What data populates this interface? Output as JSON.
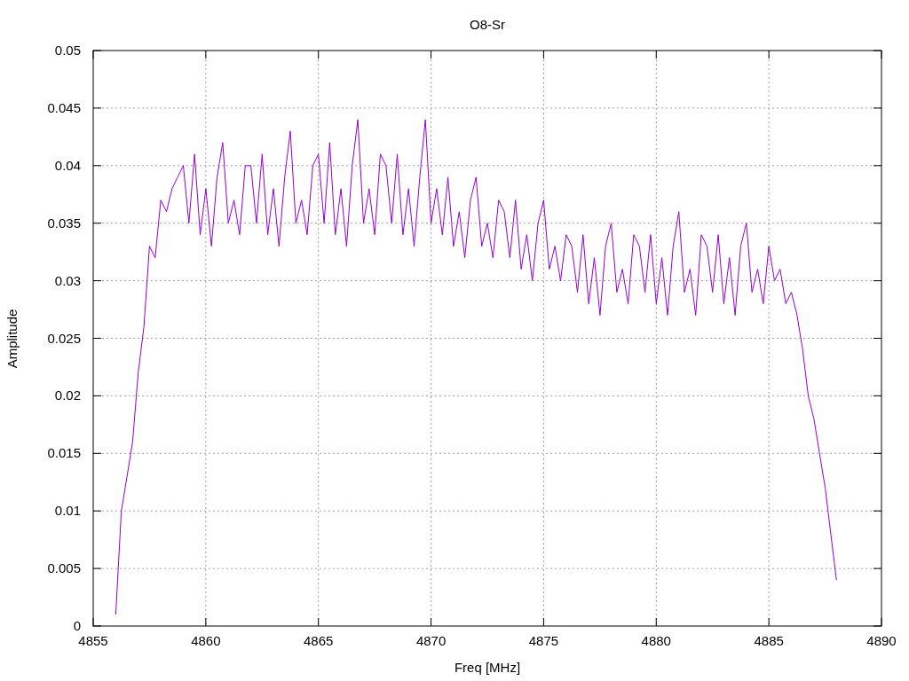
{
  "chart_data": {
    "type": "line",
    "title": "O8-Sr",
    "grid": true,
    "xlabel": "Freq [MHz]",
    "ylabel": "Amplitude",
    "xlim": [
      4855,
      4890
    ],
    "ylim": [
      0,
      0.05
    ],
    "xticks": [
      4855,
      4860,
      4865,
      4870,
      4875,
      4880,
      4885,
      4890
    ],
    "yticks": [
      0,
      0.005,
      0.01,
      0.015,
      0.02,
      0.025,
      0.03,
      0.035,
      0.04,
      0.045,
      0.05
    ],
    "x": [
      4856,
      4856.25,
      4856.5,
      4856.75,
      4857,
      4857.25,
      4857.5,
      4857.75,
      4858,
      4858.25,
      4858.5,
      4858.75,
      4859,
      4859.25,
      4859.5,
      4859.75,
      4860,
      4860.25,
      4860.5,
      4860.75,
      4861,
      4861.25,
      4861.5,
      4861.75,
      4862,
      4862.25,
      4862.5,
      4862.75,
      4863,
      4863.25,
      4863.5,
      4863.75,
      4864,
      4864.25,
      4864.5,
      4864.75,
      4865,
      4865.25,
      4865.5,
      4865.75,
      4866,
      4866.25,
      4866.5,
      4866.75,
      4867,
      4867.25,
      4867.5,
      4867.75,
      4868,
      4868.25,
      4868.5,
      4868.75,
      4869,
      4869.25,
      4869.5,
      4869.75,
      4870,
      4870.25,
      4870.5,
      4870.75,
      4871,
      4871.25,
      4871.5,
      4871.75,
      4872,
      4872.25,
      4872.5,
      4872.75,
      4873,
      4873.25,
      4873.5,
      4873.75,
      4874,
      4874.25,
      4874.5,
      4874.75,
      4875,
      4875.25,
      4875.5,
      4875.75,
      4876,
      4876.25,
      4876.5,
      4876.75,
      4877,
      4877.25,
      4877.5,
      4877.75,
      4878,
      4878.25,
      4878.5,
      4878.75,
      4879,
      4879.25,
      4879.5,
      4879.75,
      4880,
      4880.25,
      4880.5,
      4880.75,
      4881,
      4881.25,
      4881.5,
      4881.75,
      4882,
      4882.25,
      4882.5,
      4882.75,
      4883,
      4883.25,
      4883.5,
      4883.75,
      4884,
      4884.25,
      4884.5,
      4884.75,
      4885,
      4885.25,
      4885.5,
      4885.75,
      4886,
      4886.25,
      4886.5,
      4886.75,
      4887,
      4887.25,
      4887.5,
      4887.75,
      4888
    ],
    "series": [
      {
        "color": "#9400d3",
        "values": [
          0.001,
          0.01,
          0.013,
          0.016,
          0.022,
          0.026,
          0.033,
          0.032,
          0.037,
          0.036,
          0.038,
          0.039,
          0.04,
          0.035,
          0.041,
          0.034,
          0.038,
          0.033,
          0.039,
          0.042,
          0.035,
          0.037,
          0.034,
          0.04,
          0.04,
          0.035,
          0.041,
          0.034,
          0.038,
          0.033,
          0.039,
          0.043,
          0.035,
          0.037,
          0.034,
          0.04,
          0.041,
          0.035,
          0.042,
          0.034,
          0.038,
          0.033,
          0.04,
          0.044,
          0.035,
          0.038,
          0.034,
          0.041,
          0.04,
          0.035,
          0.041,
          0.034,
          0.038,
          0.033,
          0.039,
          0.044,
          0.035,
          0.038,
          0.034,
          0.039,
          0.033,
          0.036,
          0.032,
          0.037,
          0.039,
          0.033,
          0.035,
          0.032,
          0.037,
          0.036,
          0.032,
          0.037,
          0.031,
          0.034,
          0.03,
          0.035,
          0.037,
          0.031,
          0.033,
          0.03,
          0.034,
          0.033,
          0.029,
          0.034,
          0.028,
          0.032,
          0.027,
          0.033,
          0.035,
          0.029,
          0.031,
          0.028,
          0.034,
          0.033,
          0.029,
          0.034,
          0.028,
          0.032,
          0.027,
          0.033,
          0.036,
          0.029,
          0.031,
          0.027,
          0.034,
          0.033,
          0.029,
          0.034,
          0.028,
          0.032,
          0.027,
          0.033,
          0.035,
          0.029,
          0.031,
          0.028,
          0.033,
          0.03,
          0.031,
          0.028,
          0.029,
          0.027,
          0.024,
          0.02,
          0.018,
          0.015,
          0.012,
          0.008,
          0.004
        ]
      }
    ]
  }
}
